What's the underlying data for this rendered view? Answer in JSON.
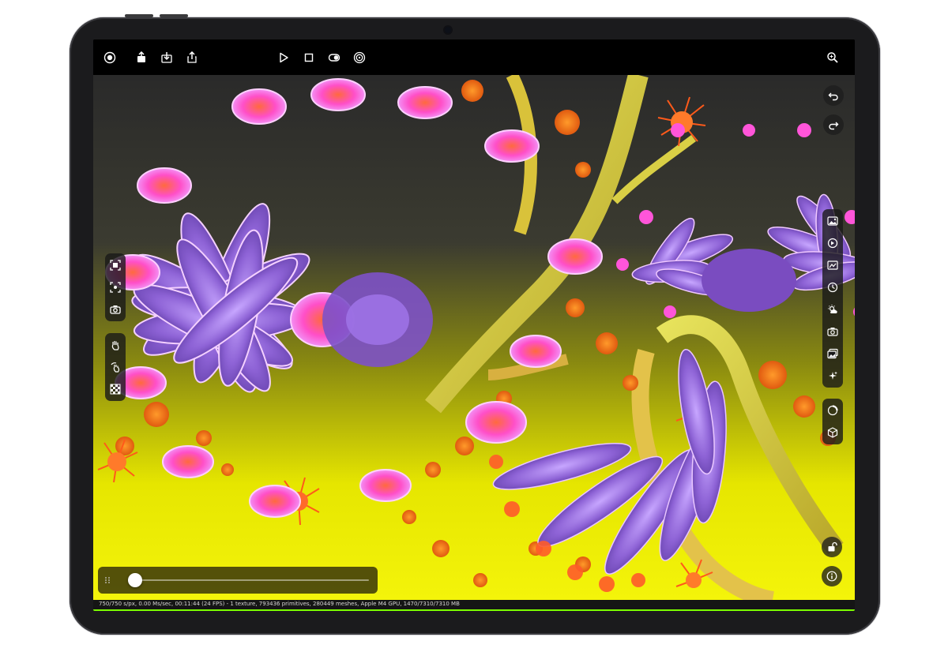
{
  "toolbar": {
    "left": [
      {
        "name": "render-target-icon",
        "label": "Render"
      },
      {
        "name": "share-icon",
        "label": "Share"
      },
      {
        "name": "import-icon",
        "label": "Import"
      },
      {
        "name": "export-icon",
        "label": "Export"
      }
    ],
    "center": [
      {
        "name": "play-icon",
        "label": "Play"
      },
      {
        "name": "stop-icon",
        "label": "Stop"
      },
      {
        "name": "toggle-icon",
        "label": "Toggle"
      },
      {
        "name": "target-icon",
        "label": "Target"
      }
    ],
    "right": [
      {
        "name": "zoom-icon",
        "label": "Zoom"
      }
    ]
  },
  "history": [
    {
      "name": "undo-icon"
    },
    {
      "name": "redo-icon"
    }
  ],
  "left_tools": {
    "group1": [
      {
        "name": "frame-select-icon"
      },
      {
        "name": "focus-icon"
      },
      {
        "name": "camera-icon"
      }
    ],
    "group2": [
      {
        "name": "hand-pan-icon"
      },
      {
        "name": "rotate-hand-icon"
      },
      {
        "name": "checker-icon"
      }
    ]
  },
  "right_tools": {
    "group1": [
      {
        "name": "image-icon"
      },
      {
        "name": "clock-arrow-icon"
      },
      {
        "name": "picture-settings-icon"
      },
      {
        "name": "history-icon"
      },
      {
        "name": "weather-icon"
      },
      {
        "name": "camera-settings-icon"
      },
      {
        "name": "gallery-icon"
      },
      {
        "name": "sparkle-icon"
      }
    ],
    "group2": [
      {
        "name": "material-sphere-icon"
      },
      {
        "name": "cube-icon"
      }
    ]
  },
  "bottom_right": [
    {
      "name": "lock-icon"
    },
    {
      "name": "info-icon"
    }
  ],
  "slider": {
    "value": 0.03
  },
  "status_text": "750/750 s/px, 0.00 Ms/sec, 00:11:44 (24 FPS) - 1 texture, 793436 primitives, 280449 meshes, Apple M4 GPU, 1470/7310/7310 MB",
  "render_progress": 1.0,
  "colors": {
    "accent": "#7CFC00",
    "ui_panel": "#191919"
  }
}
